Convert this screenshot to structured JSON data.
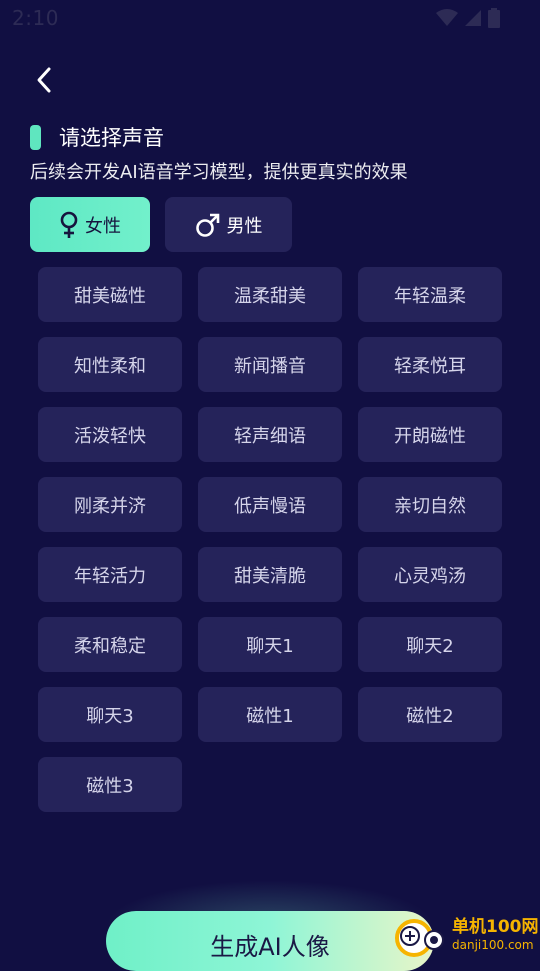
{
  "status_bar": {
    "time": "2:10",
    "icons": [
      "wifi-icon",
      "signal-icon",
      "battery-icon"
    ]
  },
  "header": {
    "back_icon": "chevron-left-icon"
  },
  "section": {
    "title": "请选择声音",
    "subtitle": "后续会开发AI语音学习模型，提供更真实的效果"
  },
  "gender_tabs": [
    {
      "label": "女性",
      "icon": "female-symbol-icon",
      "selected": true
    },
    {
      "label": "男性",
      "icon": "male-symbol-icon",
      "selected": false
    }
  ],
  "voices": [
    "甜美磁性",
    "温柔甜美",
    "年轻温柔",
    "知性柔和",
    "新闻播音",
    "轻柔悦耳",
    "活泼轻快",
    "轻声细语",
    "开朗磁性",
    "刚柔并济",
    "低声慢语",
    "亲切自然",
    "年轻活力",
    "甜美清脆",
    "心灵鸡汤",
    "柔和稳定",
    "聊天1",
    "聊天2",
    "聊天3",
    "磁性1",
    "磁性2",
    "磁性3"
  ],
  "generate_button": {
    "label": "生成AI人像"
  },
  "watermark": {
    "name": "单机100网",
    "url": "danji100.com"
  },
  "colors": {
    "background": "#110f42",
    "chip": "#25235a",
    "accent": "#5fe6bf",
    "watermark": "#f6b400"
  }
}
